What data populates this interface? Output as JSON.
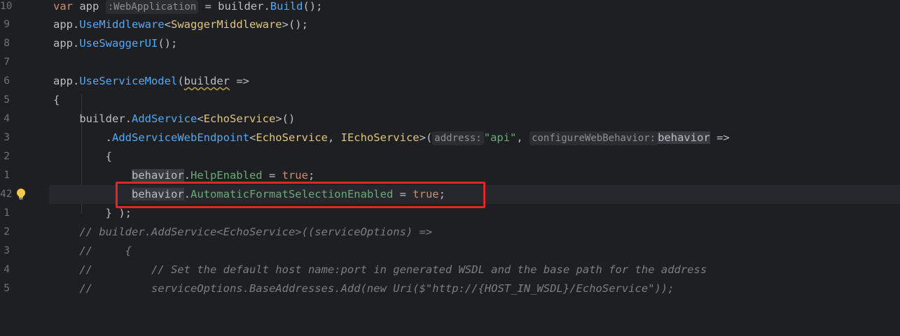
{
  "editor": {
    "line_numbers": [
      "10",
      "9",
      "8",
      "7",
      "6",
      "5",
      "4",
      "3",
      "2",
      "1",
      "42",
      "1",
      "2",
      "3",
      "4",
      "5"
    ],
    "lines": {
      "l0": {
        "kw": "var",
        "name": "app",
        "hint": ":WebApplication",
        "rest1": " = builder.",
        "method": "Build",
        "rest2": "();"
      },
      "l1": {
        "obj": "app.",
        "method": "UseMiddleware",
        "lt": "<",
        "type": "SwaggerMiddleware",
        "rest": ">();"
      },
      "l2": {
        "obj": "app.",
        "method": "UseSwaggerUI",
        "rest": "();"
      },
      "l3": {},
      "l4": {
        "obj": "app.",
        "method": "UseServiceModel",
        "paren": "(",
        "param": "builder",
        "rest": " =>"
      },
      "l5": {
        "brace": "{"
      },
      "l6": {
        "obj": "builder.",
        "method": "AddService",
        "lt": "<",
        "type": "EchoService",
        "rest": ">()"
      },
      "l7": {
        "dot": ".",
        "method": "AddServiceWebEndpoint",
        "lt": "<",
        "type1": "EchoService",
        "comma": ", ",
        "type2": "IEchoService",
        "gt": ">(",
        "hint1": "address:",
        "str": "\"api\"",
        "comma2": ", ",
        "hint2": "configureWebBehavior:",
        "param": "behavior",
        "arrow": " =>"
      },
      "l8": {
        "brace": "{"
      },
      "l9": {
        "obj": "behavior",
        "dot": ".",
        "prop": "HelpEnabled",
        "eq": " = ",
        "kw": "true",
        "semi": ";"
      },
      "l10": {
        "obj": "behavior",
        "dot": ".",
        "prop": "AutomaticFormatSelectionEnabled",
        "eq": " = ",
        "kw": "true",
        "semi": ";"
      },
      "l11": {
        "text": "} );"
      },
      "l12": {
        "comment": "// builder.AddService<EchoService>((serviceOptions) =>"
      },
      "l13": {
        "comment": "//     {"
      },
      "l14": {
        "comment": "//         // Set the default host name:port in generated WSDL and the base path for the address"
      },
      "l15": {
        "comment": "//         serviceOptions.BaseAddresses.Add(new Uri($\"http://{HOST_IN_WSDL}/EchoService\"));"
      }
    }
  },
  "colors": {
    "background": "#1e1f22",
    "highlight_box": "#e0262b",
    "keyword": "#cf8e6d",
    "method": "#56a8f5",
    "type": "#e0c57d",
    "string": "#6aab73",
    "comment": "#7a7e85"
  },
  "icons": {
    "intention_bulb": "lightbulb-icon"
  }
}
